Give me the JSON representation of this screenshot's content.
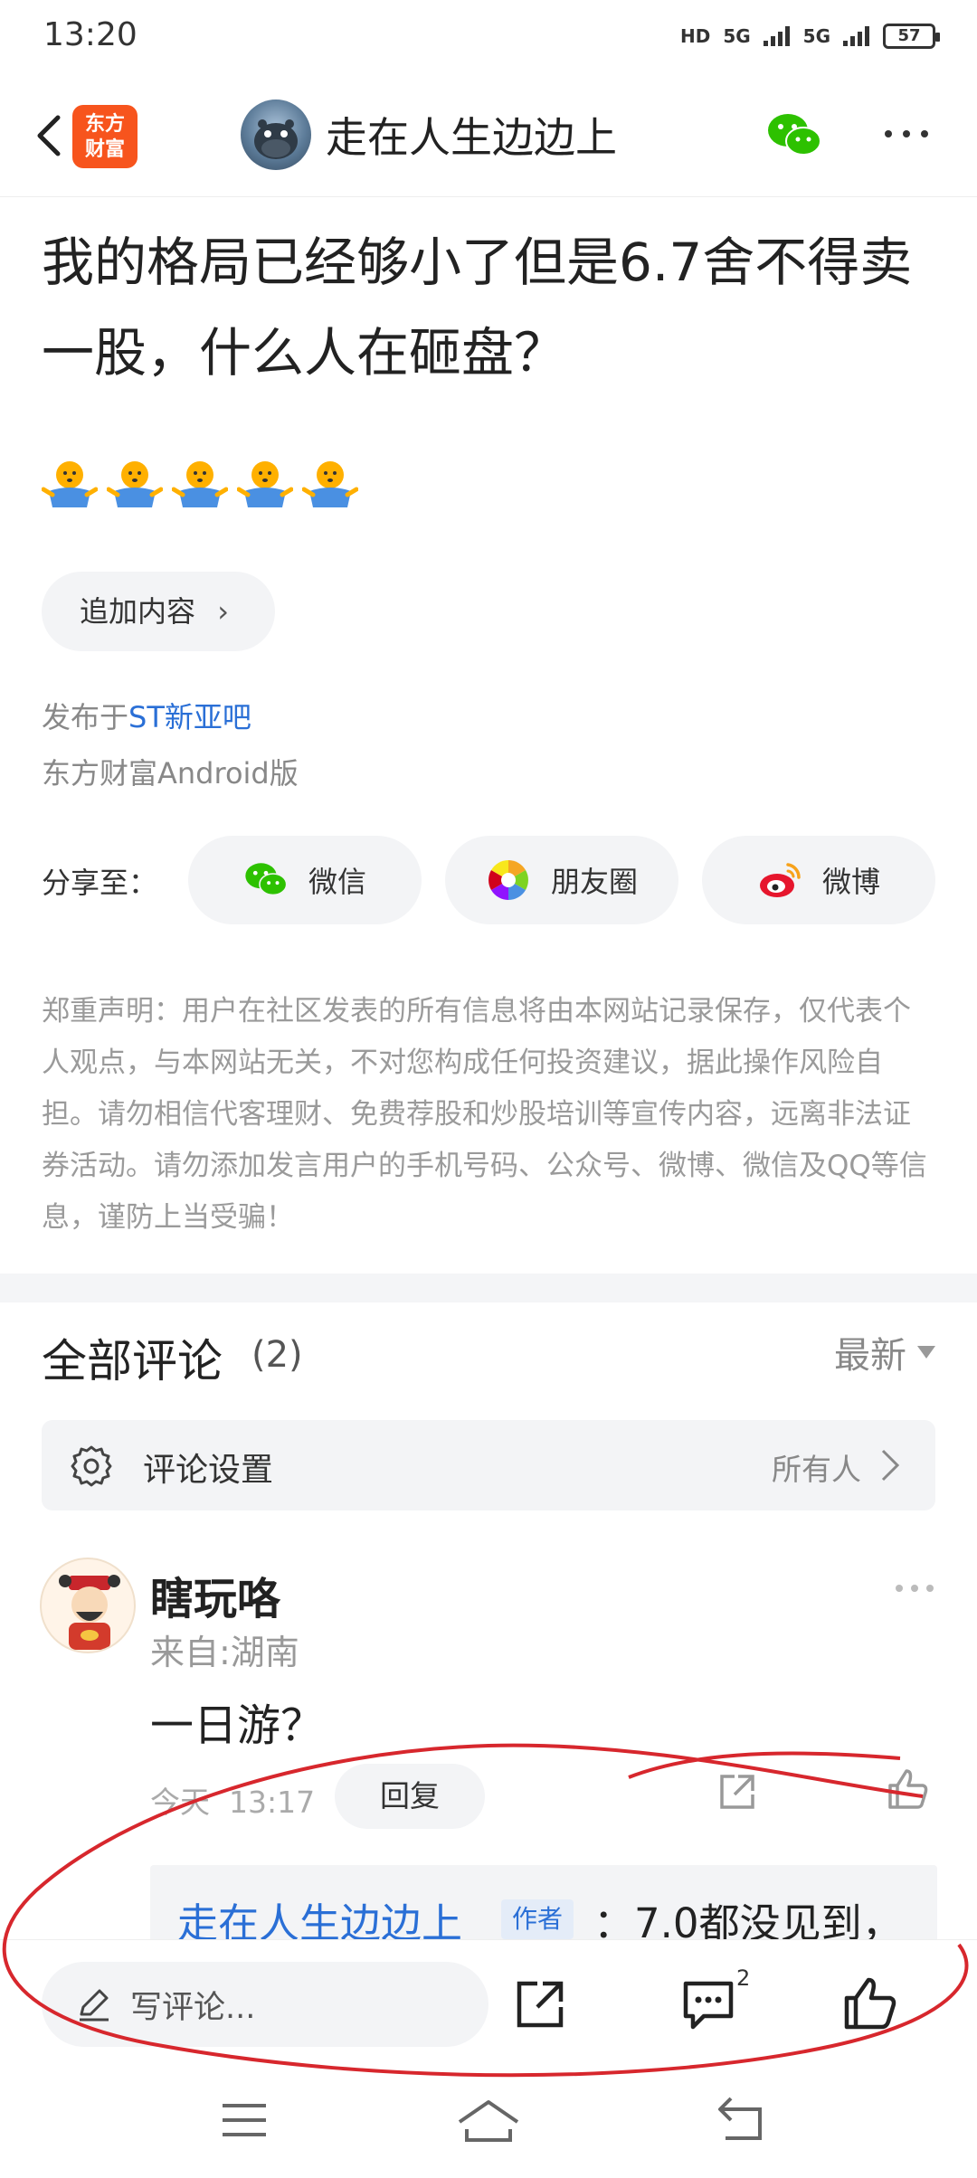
{
  "status_bar": {
    "time": "13:20",
    "network": [
      "HD",
      "5G",
      "5G"
    ],
    "battery": "57"
  },
  "header": {
    "app_logo_text": "东方\n财富",
    "title": "走在人生边边上"
  },
  "post": {
    "title": "我的格局已经够小了但是6.7舍不得卖一股，什么人在砸盘？",
    "emoji_count": 5,
    "add_content_label": "追加内容",
    "published_prefix": "发布于",
    "bar_name": "ST新亚吧",
    "client": "东方财富Android版"
  },
  "share": {
    "label": "分享至：",
    "options": [
      "微信",
      "朋友圈",
      "微博"
    ]
  },
  "disclaimer": "郑重声明：用户在社区发表的所有信息将由本网站记录保存，仅代表个人观点，与本网站无关，不对您构成任何投资建议，据此操作风险自担。请勿相信代客理财、免费荐股和炒股培训等宣传内容，远离非法证券活动。请勿添加发言用户的手机号码、公众号、微博、微信及QQ等信息，谨防上当受骗！",
  "comments": {
    "title": "全部评论",
    "count": "(2)",
    "sort": "最新",
    "settings_label": "评论设置",
    "settings_value": "所有人",
    "items": [
      {
        "author": "瞎玩咯",
        "location": "来自:湖南",
        "text": "一日游？",
        "time": "今天  13:17",
        "reply_label": "回复",
        "reply": {
          "author": "走在人生边边上",
          "tag": "作者",
          "text": "：7.0都没见到，"
        }
      }
    ]
  },
  "bottom_bar": {
    "input_placeholder": "写评论...",
    "comment_badge": "2"
  },
  "colors": {
    "accent_blue": "#2a6fd6",
    "logo_orange": "#f7541d",
    "wechat_green": "#2dc100",
    "annotation_red": "#d7272d"
  }
}
